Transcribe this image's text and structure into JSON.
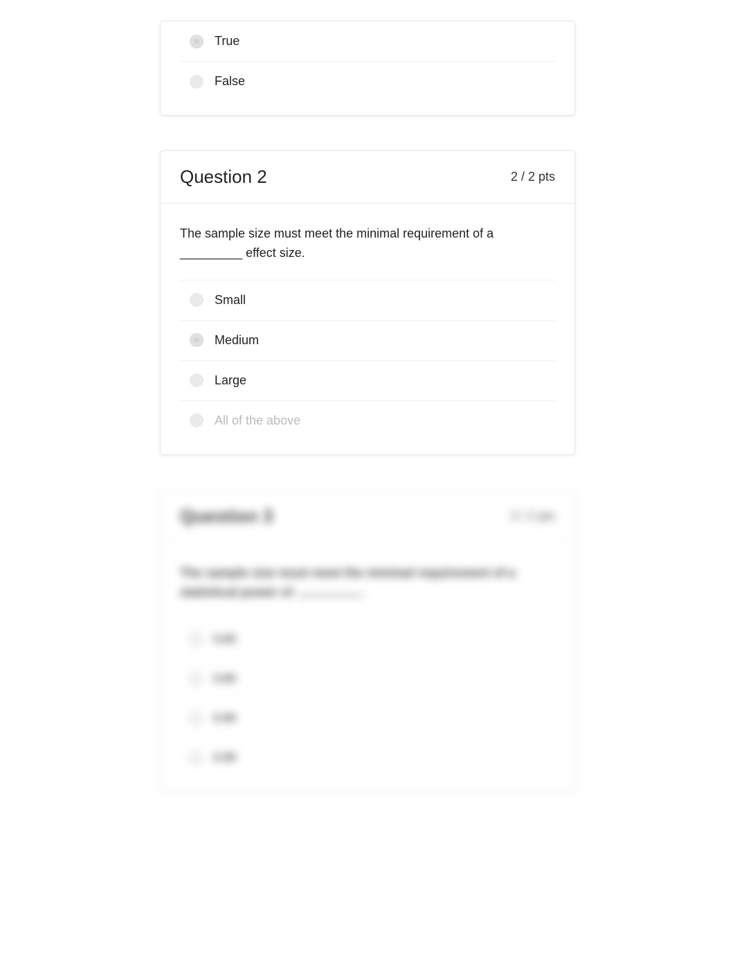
{
  "q1_partial": {
    "answers": [
      {
        "label": "True",
        "selected": true
      },
      {
        "label": "False",
        "selected": false
      }
    ]
  },
  "q2": {
    "title": "Question 2",
    "pts": "2 / 2 pts",
    "text": "The sample size must meet the minimal requirement of a _________ effect size.",
    "answers": [
      {
        "label": "Small",
        "selected": false
      },
      {
        "label": "Medium",
        "selected": true
      },
      {
        "label": "Large",
        "selected": false
      },
      {
        "label": "All of the above",
        "selected": false,
        "muted": true
      }
    ]
  },
  "q3": {
    "title": "Question 3",
    "pts": "2 / 2 pts",
    "text_prefix": "The sample size must meet the minimal requirement of a statistical power of ",
    "answers": [
      {
        "label": "0.80"
      },
      {
        "label": "0.85"
      },
      {
        "label": "0.90"
      },
      {
        "label": "0.95"
      }
    ]
  }
}
